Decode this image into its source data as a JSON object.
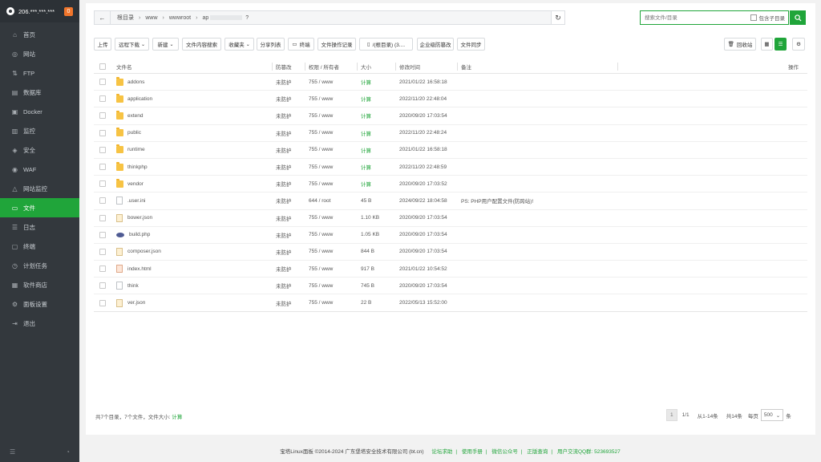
{
  "sidebar": {
    "host": "206.***.***.***",
    "badge": "0",
    "items": [
      {
        "label": "首页",
        "icon": "home-icon",
        "glyph": "⌂"
      },
      {
        "label": "网站",
        "icon": "globe-icon",
        "glyph": "◎"
      },
      {
        "label": "FTP",
        "icon": "ftp-icon",
        "glyph": "⇅"
      },
      {
        "label": "数据库",
        "icon": "database-icon",
        "glyph": "▤"
      },
      {
        "label": "Docker",
        "icon": "docker-icon",
        "glyph": "▣"
      },
      {
        "label": "监控",
        "icon": "monitor-icon",
        "glyph": "▥"
      },
      {
        "label": "安全",
        "icon": "shield-icon",
        "glyph": "◈"
      },
      {
        "label": "WAF",
        "icon": "waf-icon",
        "glyph": "◉"
      },
      {
        "label": "网站监控",
        "icon": "site-monitor-icon",
        "glyph": "△"
      },
      {
        "label": "文件",
        "icon": "folder-icon",
        "glyph": "▭"
      },
      {
        "label": "日志",
        "icon": "log-icon",
        "glyph": "☰"
      },
      {
        "label": "终端",
        "icon": "terminal-icon",
        "glyph": "▢"
      },
      {
        "label": "计划任务",
        "icon": "task-icon",
        "glyph": "◷"
      },
      {
        "label": "软件商店",
        "icon": "store-icon",
        "glyph": "▦"
      },
      {
        "label": "面板设置",
        "icon": "settings-icon",
        "glyph": "⚙"
      },
      {
        "label": "退出",
        "icon": "logout-icon",
        "glyph": "⇥"
      }
    ],
    "active_index": 9
  },
  "pathbar": {
    "crumbs": [
      "根目录",
      "www",
      "wwwroot",
      "ap"
    ],
    "tail": "?"
  },
  "search": {
    "placeholder": "搜索文件/目录",
    "include_sub": "包含子目录"
  },
  "toolbar": {
    "upload": "上传",
    "remote_download": "远程下载",
    "new": "新建",
    "content_search": "文件内容搜索",
    "favorites": "收藏夹",
    "share_list": "分享列表",
    "terminal": "终端",
    "op_log": "文件操作记录",
    "disk": "/(根目录) (3....",
    "tamper": "企业级防篡改",
    "sync": "文件同步",
    "recycle": "回收站"
  },
  "table": {
    "headers": {
      "name": "文件名",
      "tamper": "防篡改",
      "perm": "权限 / 所有者",
      "size": "大小",
      "mtime": "修改时间",
      "note": "备注",
      "ops": "操作"
    },
    "rows": [
      {
        "name": "addons",
        "type": "folder",
        "tamper": "未防护",
        "perm": "755 / www",
        "size": "计算",
        "mtime": "2021/01/22 16:58:18",
        "note": ""
      },
      {
        "name": "application",
        "type": "folder",
        "tamper": "未防护",
        "perm": "755 / www",
        "size": "计算",
        "mtime": "2022/11/20 22:48:04",
        "note": ""
      },
      {
        "name": "extend",
        "type": "folder",
        "tamper": "未防护",
        "perm": "755 / www",
        "size": "计算",
        "mtime": "2020/09/20 17:03:54",
        "note": ""
      },
      {
        "name": "public",
        "type": "folder",
        "tamper": "未防护",
        "perm": "755 / www",
        "size": "计算",
        "mtime": "2022/11/20 22:48:24",
        "note": ""
      },
      {
        "name": "runtime",
        "type": "folder",
        "tamper": "未防护",
        "perm": "755 / www",
        "size": "计算",
        "mtime": "2021/01/22 16:58:18",
        "note": ""
      },
      {
        "name": "thinkphp",
        "type": "folder",
        "tamper": "未防护",
        "perm": "755 / www",
        "size": "计算",
        "mtime": "2022/11/20 22:48:59",
        "note": ""
      },
      {
        "name": "vendor",
        "type": "folder",
        "tamper": "未防护",
        "perm": "755 / www",
        "size": "计算",
        "mtime": "2020/09/20 17:03:52",
        "note": ""
      },
      {
        "name": ".user.ini",
        "type": "file",
        "tamper": "未防护",
        "perm": "644 / root",
        "size": "45 B",
        "mtime": "2024/09/22 18:04:58",
        "note": "PS: PHP用户配置文件(防跨站)!"
      },
      {
        "name": "bower.json",
        "type": "json",
        "tamper": "未防护",
        "perm": "755 / www",
        "size": "1.10 KB",
        "mtime": "2020/09/20 17:03:54",
        "note": ""
      },
      {
        "name": "build.php",
        "type": "php",
        "tamper": "未防护",
        "perm": "755 / www",
        "size": "1.05 KB",
        "mtime": "2020/09/20 17:03:54",
        "note": ""
      },
      {
        "name": "composer.json",
        "type": "json",
        "tamper": "未防护",
        "perm": "755 / www",
        "size": "844 B",
        "mtime": "2020/09/20 17:03:54",
        "note": ""
      },
      {
        "name": "index.html",
        "type": "html",
        "tamper": "未防护",
        "perm": "755 / www",
        "size": "917 B",
        "mtime": "2021/01/22 10:54:52",
        "note": ""
      },
      {
        "name": "think",
        "type": "file",
        "tamper": "未防护",
        "perm": "755 / www",
        "size": "745 B",
        "mtime": "2020/09/20 17:03:54",
        "note": ""
      },
      {
        "name": "ver.json",
        "type": "json",
        "tamper": "未防护",
        "perm": "755 / www",
        "size": "22 B",
        "mtime": "2022/05/13 15:52:00",
        "note": ""
      }
    ]
  },
  "summary": {
    "text": "共7个目录，7个文件，文件大小:",
    "calc": "计算"
  },
  "pager": {
    "current": "1",
    "pages": "1/1",
    "range": "从1-14条",
    "total": "共14条",
    "per_page_label": "每页",
    "per_page": "500",
    "unit": "条"
  },
  "footer": {
    "copyright": "宝塔Linux面板 ©2014-2024 广东堡塔安全技术有限公司 (bt.cn)",
    "links": [
      "论坛求助",
      "使用手册",
      "微信公众号",
      "正版查询",
      "用户交流QQ群: 523693527"
    ]
  },
  "colors": {
    "accent": "#20a53a",
    "sidebar_bg": "#33383d"
  }
}
